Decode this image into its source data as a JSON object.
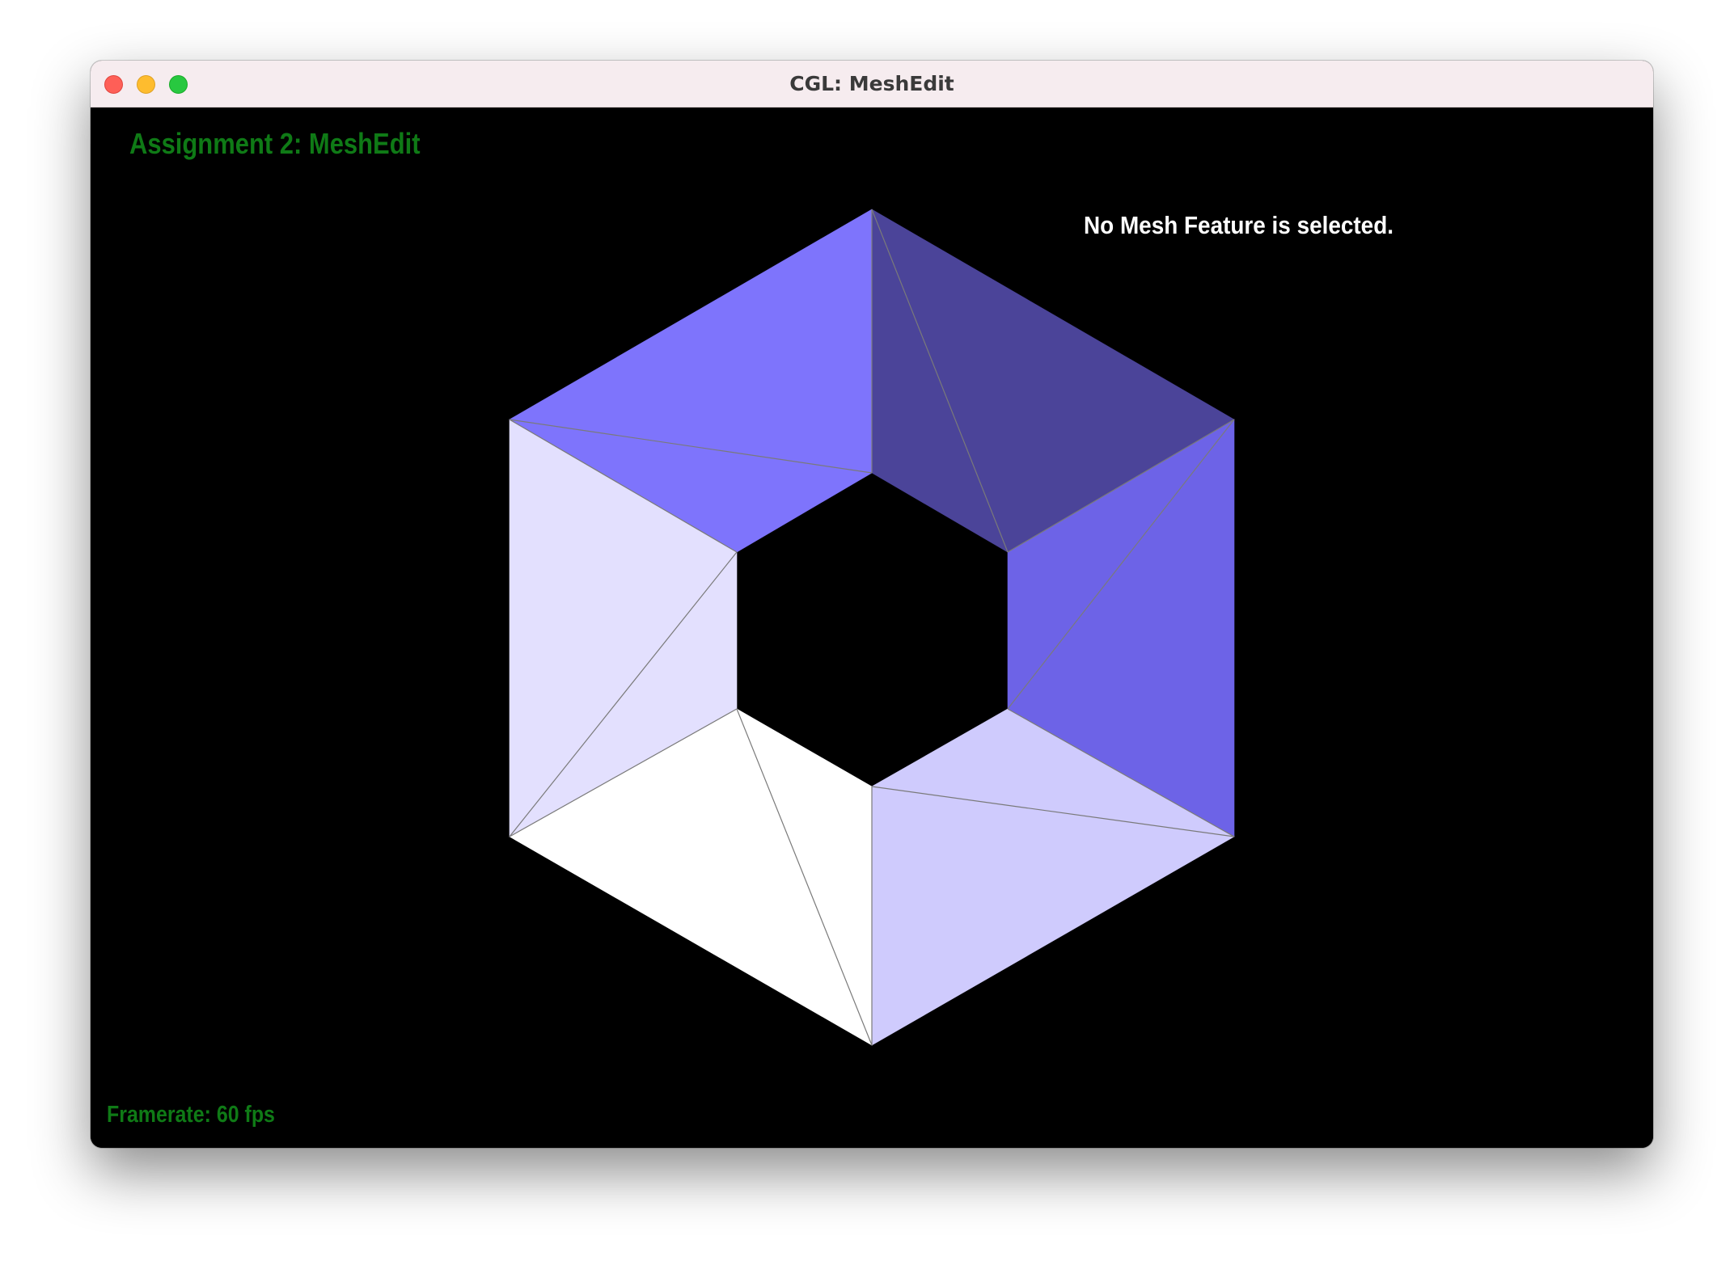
{
  "window": {
    "title": "CGL: MeshEdit"
  },
  "viewport": {
    "heading": "Assignment 2: MeshEdit",
    "selection_status": "No Mesh Feature is selected.",
    "framerate": "Framerate: 60 fps"
  },
  "colors": {
    "heading": "#0f7a16",
    "background": "#000000",
    "face_top_left": "#7e74fc",
    "face_top_right": "#4b4499",
    "face_right": "#6d63e7",
    "face_bottom_right": "#cfcbfd",
    "face_bottom_left": "#ffffff",
    "face_left": "#e3e0fe",
    "edge": "#7a7a7a"
  },
  "mesh": {
    "type": "hexagonal ring",
    "faces": 12,
    "selected_feature": null
  }
}
